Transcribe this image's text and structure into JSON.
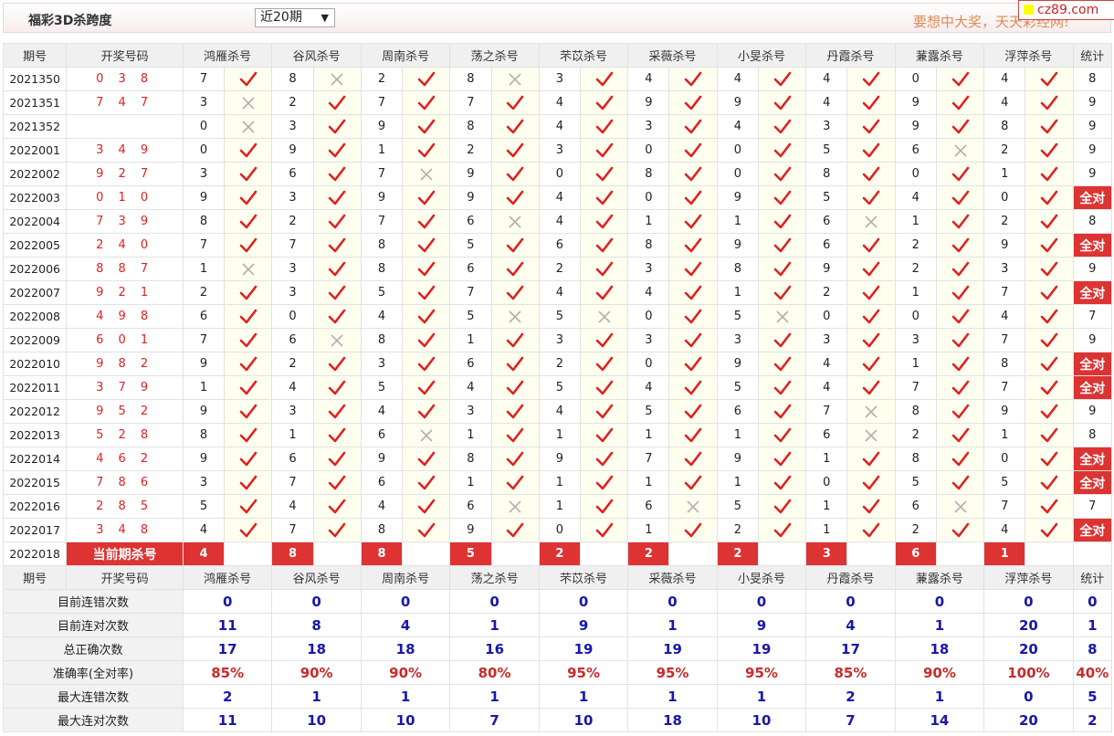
{
  "title": "福彩3D杀跨度",
  "period_select": "近20期",
  "slogan": "要想中大奖，天天彩经网!",
  "logo": "cz89.com",
  "headers": [
    "期号",
    "开奖号码",
    "鸿雁杀号",
    "谷风杀号",
    "周南杀号",
    "荡之杀号",
    "芣苡杀号",
    "采薇杀号",
    "小旻杀号",
    "丹霞杀号",
    "蒹露杀号",
    "浮萍杀号",
    "统计"
  ],
  "rows": [
    {
      "qh": "2021350",
      "kj": "0 3 8",
      "v": [
        7,
        8,
        2,
        8,
        3,
        4,
        4,
        4,
        0,
        4
      ],
      "m": [
        1,
        0,
        1,
        0,
        1,
        1,
        1,
        1,
        1,
        1
      ],
      "st": "8"
    },
    {
      "qh": "2021351",
      "kj": "7 4 7",
      "v": [
        3,
        2,
        7,
        7,
        4,
        9,
        9,
        4,
        9,
        4
      ],
      "m": [
        0,
        1,
        1,
        1,
        1,
        1,
        1,
        1,
        1,
        1
      ],
      "st": "9"
    },
    {
      "qh": "2021352",
      "kj": "",
      "v": [
        0,
        3,
        9,
        8,
        4,
        3,
        4,
        3,
        9,
        8
      ],
      "m": [
        0,
        1,
        1,
        1,
        1,
        1,
        1,
        1,
        1,
        1
      ],
      "st": "9"
    },
    {
      "qh": "2022001",
      "kj": "3 4 9",
      "v": [
        0,
        9,
        1,
        2,
        3,
        0,
        0,
        5,
        6,
        2
      ],
      "m": [
        1,
        1,
        1,
        1,
        1,
        1,
        1,
        1,
        0,
        1
      ],
      "st": "9"
    },
    {
      "qh": "2022002",
      "kj": "9 2 7",
      "v": [
        3,
        6,
        7,
        9,
        0,
        8,
        0,
        8,
        0,
        1
      ],
      "m": [
        1,
        1,
        0,
        1,
        1,
        1,
        1,
        1,
        1,
        1
      ],
      "st": "9"
    },
    {
      "qh": "2022003",
      "kj": "0 1 0",
      "v": [
        9,
        3,
        9,
        9,
        4,
        0,
        9,
        5,
        4,
        0
      ],
      "m": [
        1,
        1,
        1,
        1,
        1,
        1,
        1,
        1,
        1,
        1
      ],
      "st": "全对"
    },
    {
      "qh": "2022004",
      "kj": "7 3 9",
      "v": [
        8,
        2,
        7,
        6,
        4,
        1,
        1,
        6,
        1,
        2
      ],
      "m": [
        1,
        1,
        1,
        0,
        1,
        1,
        1,
        0,
        1,
        1
      ],
      "st": "8"
    },
    {
      "qh": "2022005",
      "kj": "2 4 0",
      "v": [
        7,
        7,
        8,
        5,
        6,
        8,
        9,
        6,
        2,
        9
      ],
      "m": [
        1,
        1,
        1,
        1,
        1,
        1,
        1,
        1,
        1,
        1
      ],
      "st": "全对"
    },
    {
      "qh": "2022006",
      "kj": "8 8 7",
      "v": [
        1,
        3,
        8,
        6,
        2,
        3,
        8,
        9,
        2,
        3
      ],
      "m": [
        0,
        1,
        1,
        1,
        1,
        1,
        1,
        1,
        1,
        1
      ],
      "st": "9"
    },
    {
      "qh": "2022007",
      "kj": "9 2 1",
      "v": [
        2,
        3,
        5,
        7,
        4,
        4,
        1,
        2,
        1,
        7
      ],
      "m": [
        1,
        1,
        1,
        1,
        1,
        1,
        1,
        1,
        1,
        1
      ],
      "st": "全对"
    },
    {
      "qh": "2022008",
      "kj": "4 9 8",
      "v": [
        6,
        0,
        4,
        5,
        5,
        0,
        5,
        0,
        0,
        4
      ],
      "m": [
        1,
        1,
        1,
        0,
        0,
        1,
        0,
        1,
        1,
        1
      ],
      "st": "7"
    },
    {
      "qh": "2022009",
      "kj": "6 0 1",
      "v": [
        7,
        6,
        8,
        1,
        3,
        3,
        3,
        3,
        3,
        7
      ],
      "m": [
        1,
        0,
        1,
        1,
        1,
        1,
        1,
        1,
        1,
        1
      ],
      "st": "9"
    },
    {
      "qh": "2022010",
      "kj": "9 8 2",
      "v": [
        9,
        2,
        3,
        6,
        2,
        0,
        9,
        4,
        1,
        8
      ],
      "m": [
        1,
        1,
        1,
        1,
        1,
        1,
        1,
        1,
        1,
        1
      ],
      "st": "全对"
    },
    {
      "qh": "2022011",
      "kj": "3 7 9",
      "v": [
        1,
        4,
        5,
        4,
        5,
        4,
        5,
        4,
        7,
        7
      ],
      "m": [
        1,
        1,
        1,
        1,
        1,
        1,
        1,
        1,
        1,
        1
      ],
      "st": "全对"
    },
    {
      "qh": "2022012",
      "kj": "9 5 2",
      "v": [
        9,
        3,
        4,
        3,
        4,
        5,
        6,
        7,
        8,
        9
      ],
      "m": [
        1,
        1,
        1,
        1,
        1,
        1,
        1,
        0,
        1,
        1
      ],
      "st": "9"
    },
    {
      "qh": "2022013",
      "kj": "5 2 8",
      "v": [
        8,
        1,
        6,
        1,
        1,
        1,
        1,
        6,
        2,
        1
      ],
      "m": [
        1,
        1,
        0,
        1,
        1,
        1,
        1,
        0,
        1,
        1
      ],
      "st": "8"
    },
    {
      "qh": "2022014",
      "kj": "4 6 2",
      "v": [
        9,
        6,
        9,
        8,
        9,
        7,
        9,
        1,
        8,
        0
      ],
      "m": [
        1,
        1,
        1,
        1,
        1,
        1,
        1,
        1,
        1,
        1
      ],
      "st": "全对"
    },
    {
      "qh": "2022015",
      "kj": "7 8 6",
      "v": [
        3,
        7,
        6,
        1,
        1,
        1,
        1,
        0,
        5,
        5
      ],
      "m": [
        1,
        1,
        1,
        1,
        1,
        1,
        1,
        1,
        1,
        1
      ],
      "st": "全对"
    },
    {
      "qh": "2022016",
      "kj": "2 8 5",
      "v": [
        5,
        4,
        4,
        6,
        1,
        6,
        5,
        1,
        6,
        7
      ],
      "m": [
        1,
        1,
        1,
        0,
        1,
        0,
        1,
        1,
        0,
        1
      ],
      "st": "7"
    },
    {
      "qh": "2022017",
      "kj": "3 4 8",
      "v": [
        4,
        7,
        8,
        9,
        0,
        1,
        2,
        1,
        2,
        4
      ],
      "m": [
        1,
        1,
        1,
        1,
        1,
        1,
        1,
        1,
        1,
        1
      ],
      "st": "全对"
    }
  ],
  "current": {
    "qh": "2022018",
    "label": "当前期杀号",
    "v": [
      "4",
      "8",
      "8",
      "5",
      "2",
      "2",
      "2",
      "3",
      "6",
      "1"
    ]
  },
  "stats_header": [
    "期号",
    "开奖号码",
    "鸿雁杀号",
    "谷风杀号",
    "周南杀号",
    "荡之杀号",
    "芣苡杀号",
    "采薇杀号",
    "小旻杀号",
    "丹霞杀号",
    "蒹露杀号",
    "浮萍杀号",
    "统计"
  ],
  "stats": [
    {
      "label": "目前连错次数",
      "vals": [
        "0",
        "0",
        "0",
        "0",
        "0",
        "0",
        "0",
        "0",
        "0",
        "0",
        "0"
      ],
      "cls": "blue"
    },
    {
      "label": "目前连对次数",
      "vals": [
        "11",
        "8",
        "4",
        "1",
        "9",
        "1",
        "9",
        "4",
        "1",
        "20",
        "1"
      ],
      "cls": "blue"
    },
    {
      "label": "总正确次数",
      "vals": [
        "17",
        "18",
        "18",
        "16",
        "19",
        "19",
        "19",
        "17",
        "18",
        "20",
        "8"
      ],
      "cls": "blue"
    },
    {
      "label": "准确率(全对率)",
      "vals": [
        "85%",
        "90%",
        "90%",
        "80%",
        "95%",
        "95%",
        "95%",
        "85%",
        "90%",
        "100%",
        "40%"
      ],
      "cls": "red"
    },
    {
      "label": "最大连错次数",
      "vals": [
        "2",
        "1",
        "1",
        "1",
        "1",
        "1",
        "1",
        "2",
        "1",
        "0",
        "5"
      ],
      "cls": "blue"
    },
    {
      "label": "最大连对次数",
      "vals": [
        "11",
        "10",
        "10",
        "7",
        "10",
        "18",
        "10",
        "7",
        "14",
        "20",
        "2"
      ],
      "cls": "blue"
    }
  ]
}
